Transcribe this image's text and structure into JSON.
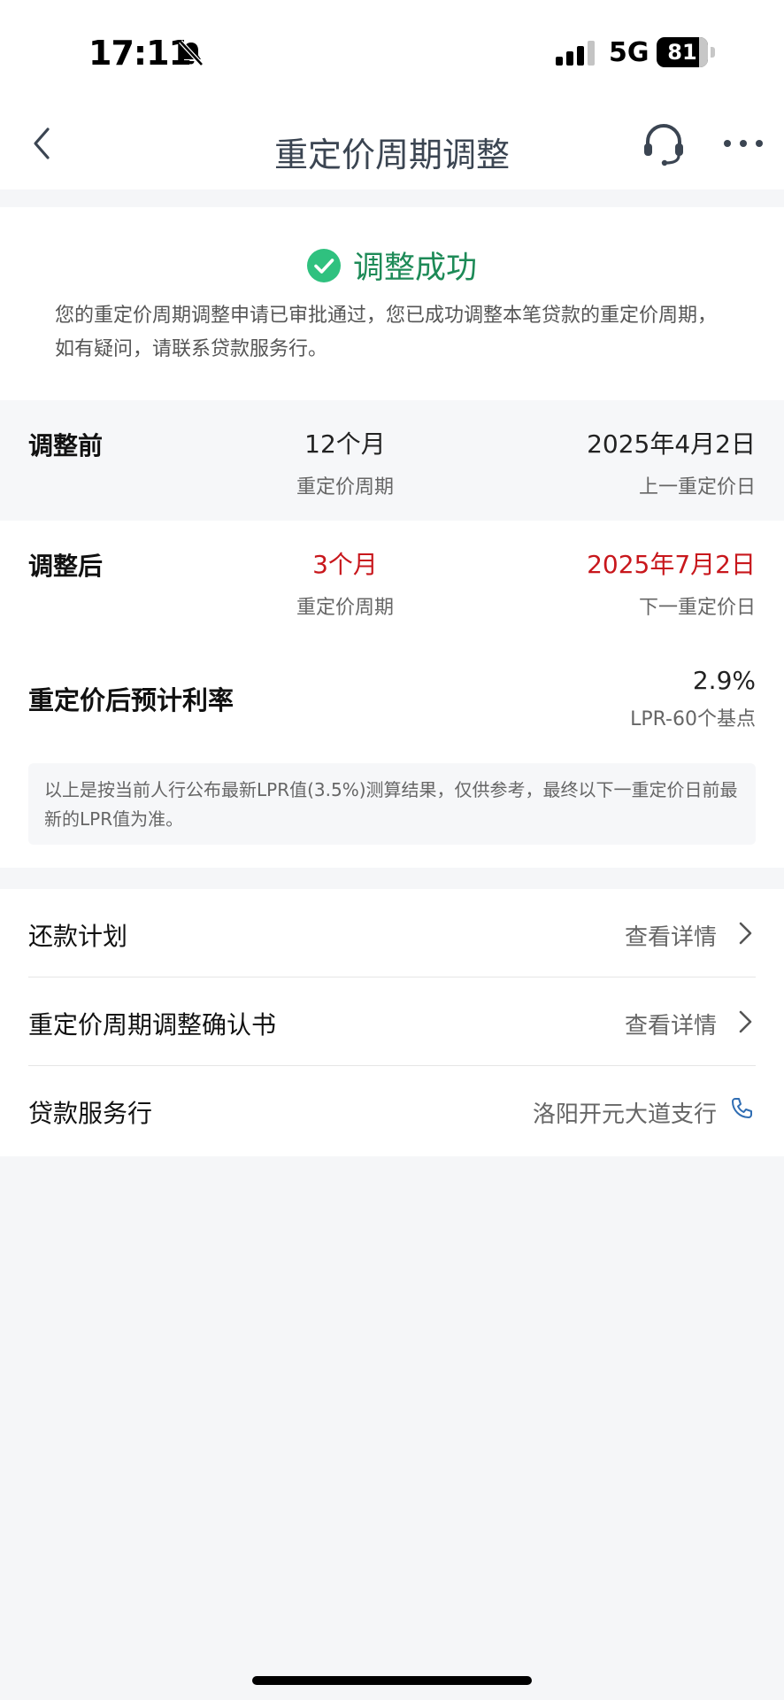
{
  "status_bar": {
    "time": "17:11",
    "network": "5G",
    "battery": "81"
  },
  "nav": {
    "title": "重定价周期调整",
    "icons": [
      "back-arrow-icon",
      "customer-service-headset-icon",
      "more-dots-icon"
    ]
  },
  "success": {
    "title": "调整成功",
    "description": "您的重定价周期调整申请已审批通过，您已成功调整本笔贷款的重定价周期，如有疑问，请联系贷款服务行。",
    "accent_color": "#1d8a57",
    "icon": "check-circle-icon"
  },
  "before": {
    "label": "调整前",
    "period_value": "12个月",
    "period_caption": "重定价周期",
    "date_value": "2025年4月2日",
    "date_caption": "上一重定价日"
  },
  "after": {
    "label": "调整后",
    "period_value": "3个月",
    "period_caption": "重定价周期",
    "date_value": "2025年7月2日",
    "date_caption": "下一重定价日",
    "highlight_color": "#c8171c"
  },
  "rate": {
    "label": "重定价后预计利率",
    "value": "2.9%",
    "detail": "LPR-60个基点",
    "note": "以上是按当前人行公布最新LPR值(3.5%)测算结果，仅供参考，最终以下一重定价日前最新的LPR值为准。"
  },
  "list": [
    {
      "label": "还款计划",
      "value": "查看详情",
      "icon": "chevron-right-icon"
    },
    {
      "label": "重定价周期调整确认书",
      "value": "查看详情",
      "icon": "chevron-right-icon"
    },
    {
      "label": "贷款服务行",
      "value": "洛阳开元大道支行",
      "icon": "phone-icon"
    }
  ]
}
